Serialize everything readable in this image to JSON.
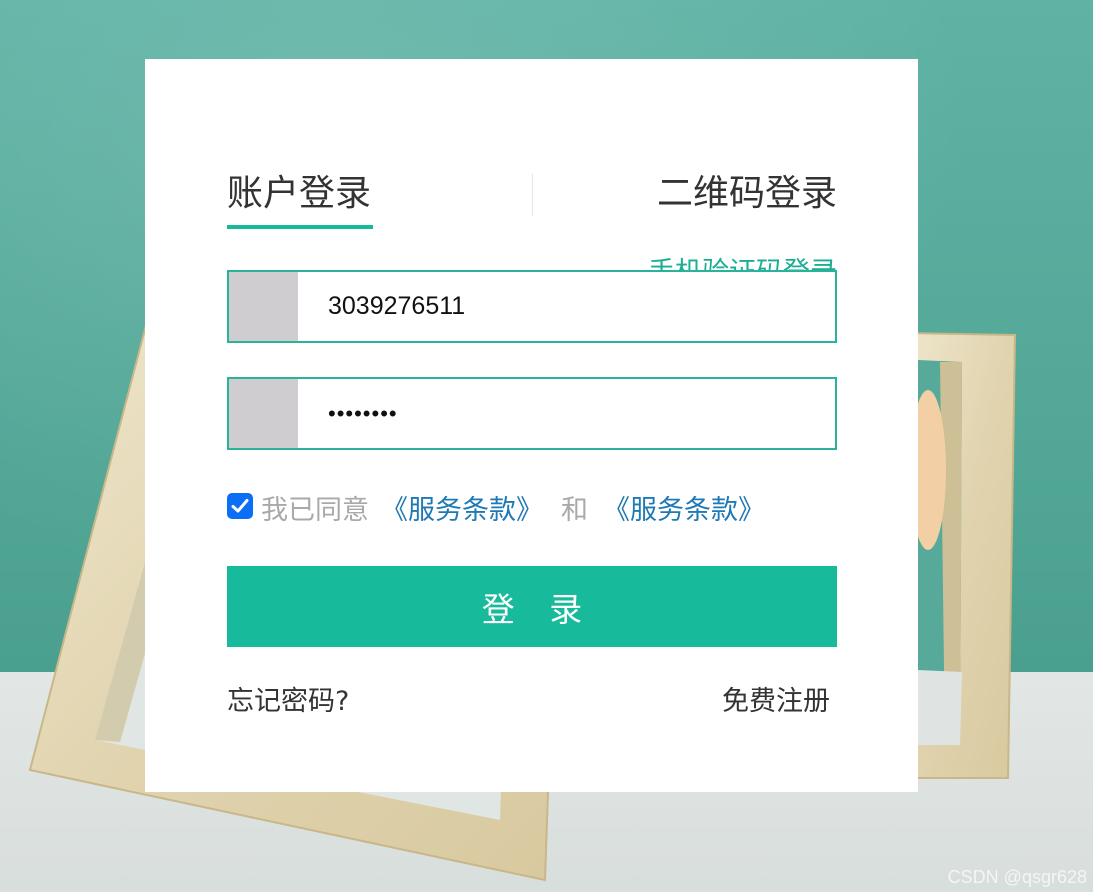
{
  "tabs": {
    "account_login": "账户登录",
    "qr_login": "二维码登录"
  },
  "sms_login_link": "手机验证码登录",
  "form": {
    "username_value": "3039276511",
    "password_value": "••••••••",
    "agree_checked": true,
    "agree_prefix": "我已同意",
    "terms_link_1": "《服务条款》",
    "agree_and": "和",
    "terms_link_2": "《服务条款》",
    "login_button": "登 录"
  },
  "footer": {
    "forgot_password": "忘记密码?",
    "register": "免费注册"
  },
  "watermark": "CSDN @qsgr628",
  "colors": {
    "accent": "#17ba9b",
    "link_blue": "#1f79b4",
    "checkbox_blue": "#0b6ff5",
    "field_icon_bg": "#cfcdcf"
  }
}
